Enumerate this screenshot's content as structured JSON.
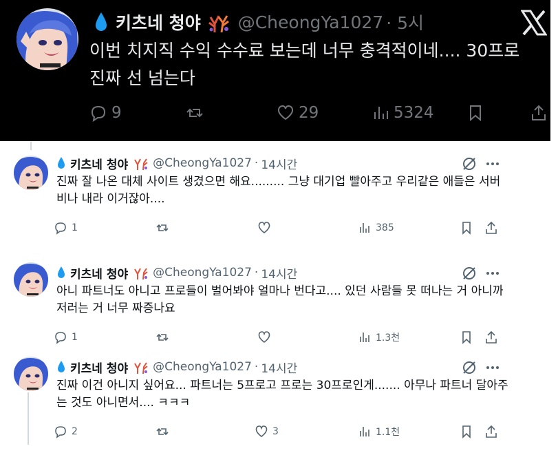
{
  "main_tweet": {
    "display_name": "키츠네 청야",
    "handle": "@CheongYa1027",
    "time": "· 5시",
    "text": "이번 치지직 수익 수수료 보는데 너무 충격적이네.... 30프로 진짜 선 넘는다",
    "replies": "9",
    "reposts": "",
    "likes": "29",
    "views": "5324"
  },
  "replies": [
    {
      "display_name": "키츠네 청야",
      "handle": "@CheongYa1027",
      "separator": "·",
      "time": "14시간",
      "text": "진짜 잘 나온 대체 사이트 생겼으면 해요......... 그냥 대기업 빨아주고 우리같은 애들은 서버비나 내라 이거잖아....",
      "replies": "1",
      "likes": "",
      "views": "385"
    },
    {
      "display_name": "키츠네 청야",
      "handle": "@CheongYa1027",
      "separator": "·",
      "time": "14시간",
      "text": "아니 파트너도 아니고 프로들이 벌어봐야 얼마나 번다고.... 있던 사람들 못 떠나는 거 아니까 저러는 거 너무 짜증나요",
      "replies": "1",
      "likes": "",
      "views": "1.3천"
    },
    {
      "display_name": "키츠네 청야",
      "handle": "@CheongYa1027",
      "separator": "·",
      "time": "14시간",
      "text": "진짜 이건 아니지 싶어요... 파트너는 5프로고 프로는 30프로인게....... 아무나 파트너 달아주는 것도 아니면서.... ㅋㅋㅋ",
      "replies": "2",
      "likes": "3",
      "views": "1.1천"
    }
  ],
  "colors": {
    "accent_blue": "#1d9bf0",
    "dark_bg": "#000000",
    "dark_text": "#e7e9ea",
    "muted": "#536471",
    "dark_muted": "#71767b"
  },
  "icons": [
    "water-drop-icon",
    "coral-badge-icon",
    "x-logo-icon",
    "reply-icon",
    "repost-icon",
    "like-icon",
    "views-icon",
    "bookmark-icon",
    "share-icon",
    "grok-icon",
    "more-icon"
  ]
}
